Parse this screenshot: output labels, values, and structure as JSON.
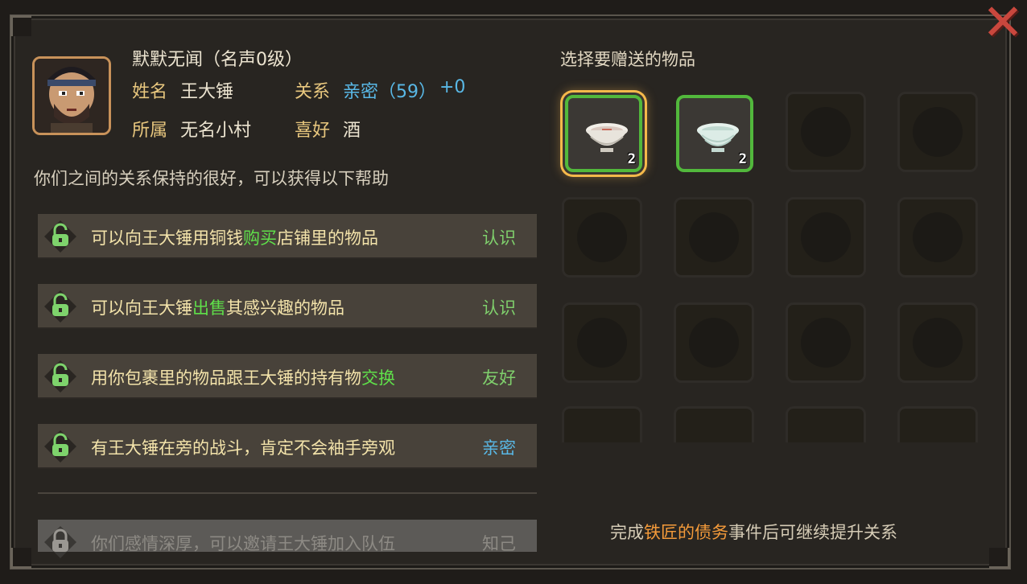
{
  "profile": {
    "title": "默默无闻（名声0级）",
    "name_label": "姓名",
    "name": "王大锤",
    "relation_label": "关系",
    "relation": "亲密（59）",
    "relation_delta": "+0",
    "faction_label": "所属",
    "faction": "无名小村",
    "hobby_label": "喜好",
    "hobby": "酒"
  },
  "intro": "你们之间的关系保持的很好，可以获得以下帮助",
  "benefits": [
    {
      "pre": "可以向王大锤用铜钱",
      "hl": "购买",
      "post": "店铺里的物品",
      "req": "认识"
    },
    {
      "pre": "可以向王大锤",
      "hl": "出售",
      "post": "其感兴趣的物品",
      "req": "认识"
    },
    {
      "pre": "用你包裹里的物品跟王大锤的持有物",
      "hl": "交换",
      "post": "",
      "req": "友好"
    },
    {
      "pre": "有王大锤在旁的战斗，肯定不会袖手旁观",
      "hl": "",
      "post": "",
      "req": "亲密"
    }
  ],
  "locked_benefit": {
    "text": "你们感情深厚，可以邀请王大锤加入队伍",
    "req": "知己"
  },
  "gift": {
    "title": "选择要赠送的物品",
    "items": [
      {
        "icon": "bowl-icon",
        "count": "2",
        "selected": true
      },
      {
        "icon": "bowl-icon",
        "count": "2",
        "selected": false
      }
    ]
  },
  "footer": {
    "pre": "完成",
    "event": "铁匠的债务",
    "post": "事件后可继续提升关系"
  },
  "colors": {
    "highlight": "#5fe04a",
    "relation": "#59b8e6",
    "event": "#f39a3a",
    "slot_border": "#52b83c"
  }
}
